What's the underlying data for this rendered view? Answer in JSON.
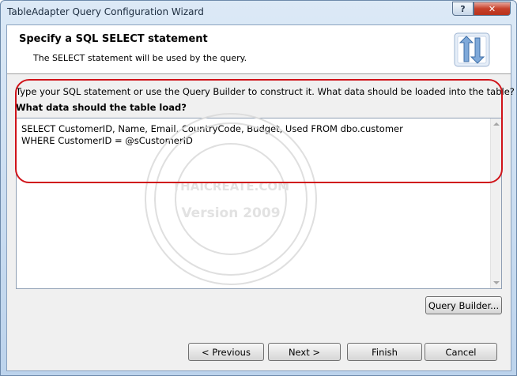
{
  "window": {
    "title": "TableAdapter Query Configuration Wizard",
    "help_label": "?",
    "close_label": "✕"
  },
  "header": {
    "title": "Specify a SQL SELECT statement",
    "subtitle": "The SELECT statement will be used by the query.",
    "graphic_icon": "database-arrows-icon"
  },
  "body": {
    "instruction": "Type your SQL statement or use the Query Builder to construct it. What data should be loaded into the table?",
    "question": "What data should the table load?",
    "sql_text": "SELECT CustomerID, Name, Email, CountryCode, Budget, Used FROM dbo.customer\nWHERE CustomerID = @sCustomerID"
  },
  "watermark": {
    "line1": "THAICREATE.COM",
    "line2": "Version 2009"
  },
  "buttons": {
    "query_builder": "Query Builder...",
    "previous": "< Previous",
    "next": "Next >",
    "finish": "Finish",
    "cancel": "Cancel"
  },
  "colors": {
    "highlight": "#d0141a",
    "header_bg": "#ffffff",
    "client_bg": "#f0f0f0"
  }
}
